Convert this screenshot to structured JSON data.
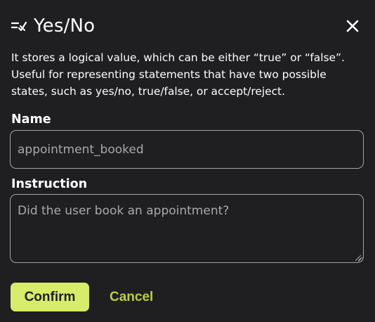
{
  "dialog": {
    "title": "Yes/No",
    "title_icon": "checklist-cross-icon",
    "close_icon": "close-icon",
    "description": "It stores a logical value, which can be either “true” or “false”. Useful for representing statements that have two possible states, such as yes/no, true/false, or accept/reject."
  },
  "fields": {
    "name": {
      "label": "Name",
      "value": "appointment_booked"
    },
    "instruction": {
      "label": "Instruction",
      "value": "Did the user book an appointment?"
    }
  },
  "actions": {
    "confirm_label": "Confirm",
    "cancel_label": "Cancel"
  },
  "colors": {
    "background": "#1f1f21",
    "accent": "#d7ec69",
    "cancel_text": "#b7cf3e",
    "border": "#a3a3a6"
  }
}
